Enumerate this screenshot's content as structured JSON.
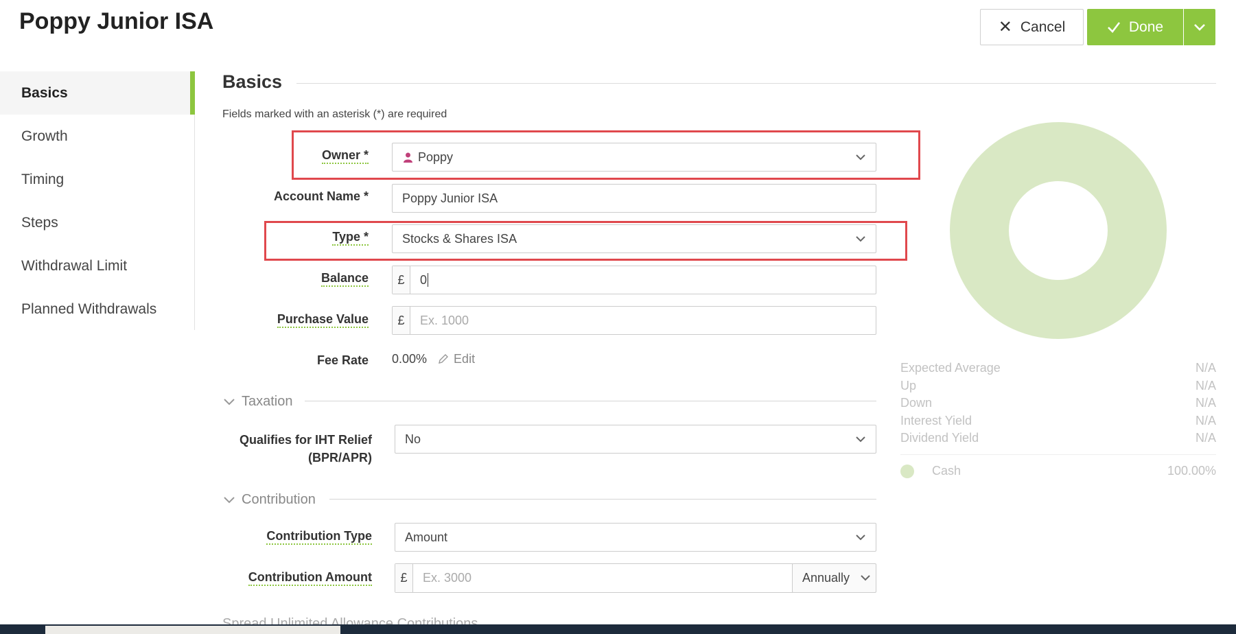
{
  "header": {
    "title": "Poppy Junior ISA",
    "cancel_label": "Cancel",
    "done_label": "Done"
  },
  "sidebar": {
    "items": [
      {
        "label": "Basics",
        "active": true
      },
      {
        "label": "Growth"
      },
      {
        "label": "Timing"
      },
      {
        "label": "Steps"
      },
      {
        "label": "Withdrawal Limit"
      },
      {
        "label": "Planned Withdrawals"
      }
    ]
  },
  "section": {
    "title": "Basics",
    "required_note": "Fields marked with an asterisk (*) are required"
  },
  "form": {
    "owner": {
      "label": "Owner *",
      "value": "Poppy",
      "icon": "person-icon"
    },
    "account_name": {
      "label": "Account Name *",
      "value": "Poppy Junior ISA"
    },
    "type": {
      "label": "Type *",
      "value": "Stocks & Shares ISA"
    },
    "balance": {
      "label": "Balance",
      "currency": "£",
      "value": "0"
    },
    "purchase_value": {
      "label": "Purchase Value",
      "currency": "£",
      "placeholder": "Ex. 1000"
    },
    "fee_rate": {
      "label": "Fee Rate",
      "value": "0.00%",
      "edit_label": "Edit"
    }
  },
  "taxation": {
    "title": "Taxation",
    "iht_label_line1": "Qualifies for IHT Relief",
    "iht_label_line2": "(BPR/APR)",
    "iht_value": "No"
  },
  "contribution": {
    "title": "Contribution",
    "type_label": "Contribution Type",
    "type_value": "Amount",
    "amount_label": "Contribution Amount",
    "amount_currency": "£",
    "amount_placeholder": "Ex. 3000",
    "frequency": "Annually"
  },
  "next_section_partial": "Spread Unlimited Allowance Contributions",
  "right_panel": {
    "stats": [
      {
        "label": "Expected Average",
        "value": "N/A"
      },
      {
        "label": "Up",
        "value": "N/A"
      },
      {
        "label": "Down",
        "value": "N/A"
      },
      {
        "label": "Interest Yield",
        "value": "N/A"
      },
      {
        "label": "Dividend Yield",
        "value": "N/A"
      }
    ],
    "allocation": [
      {
        "name": "Cash",
        "percent": "100.00%",
        "color": "#d9e8c4"
      }
    ]
  },
  "colors": {
    "accent": "#8dc63f",
    "highlight": "#e0484d",
    "owner_icon": "#c0407a"
  }
}
